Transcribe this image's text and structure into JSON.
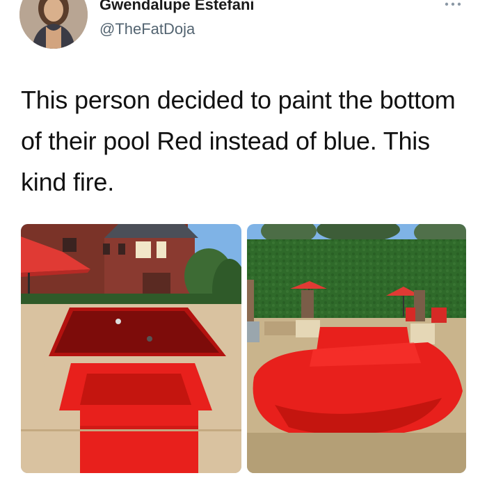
{
  "tweet": {
    "author_name": "Gwendalupe Estefani",
    "author_handle": "@TheFatDoja",
    "text": "This person decided to paint the bottom of their pool Red instead of blue. This kind fire.",
    "more_icon": "more-horizontal-icon"
  },
  "media": [
    {
      "subject": "red-painted pool beside brick house"
    },
    {
      "subject": "red-painted pool in front of hedge"
    }
  ],
  "colors": {
    "pool_red": "#e8201c",
    "hedge_green": "#2f6a2a",
    "brick": "#8a3a30",
    "sky": "#7fb3e6"
  }
}
